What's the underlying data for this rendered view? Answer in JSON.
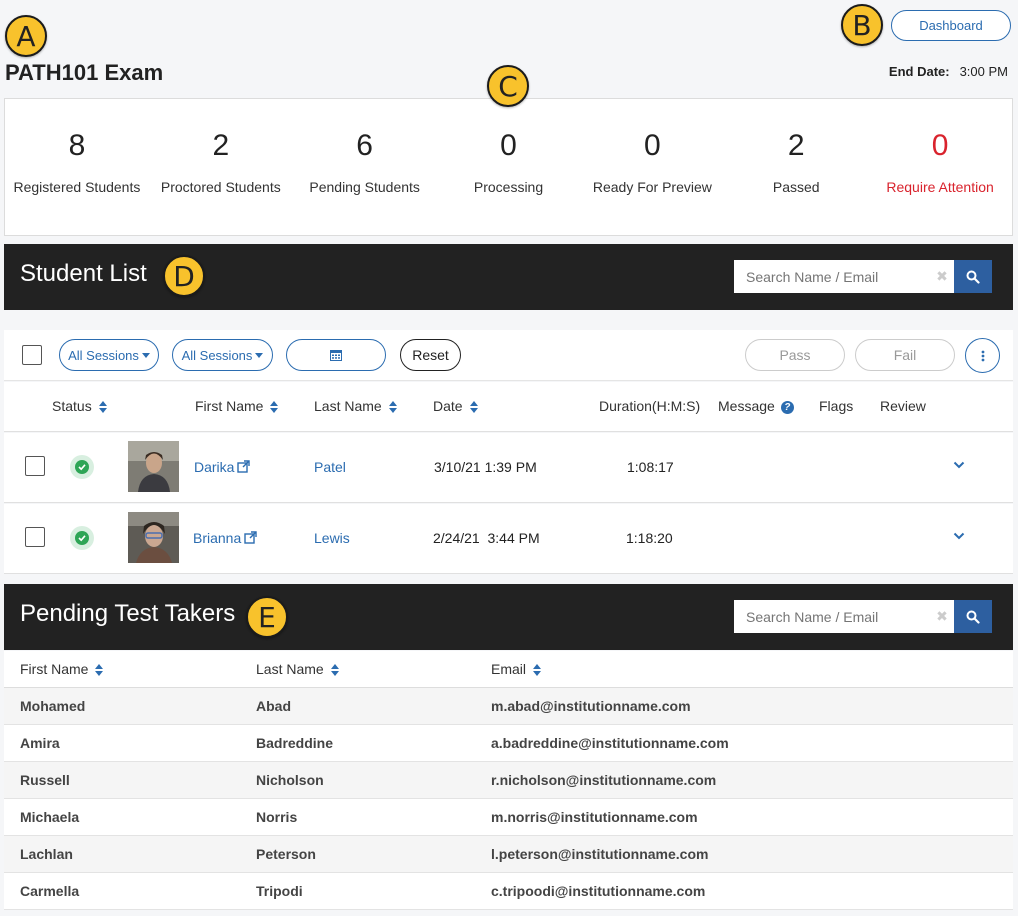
{
  "annotations": [
    "A",
    "B",
    "C",
    "D",
    "E"
  ],
  "header": {
    "title": "PATH101 Exam",
    "dashboard_label": "Dashboard",
    "end_date_label": "End Date:",
    "end_date_value": "3:00 PM"
  },
  "stats": [
    {
      "value": "8",
      "label": "Registered Students"
    },
    {
      "value": "2",
      "label": "Proctored Students"
    },
    {
      "value": "6",
      "label": "Pending Students"
    },
    {
      "value": "0",
      "label": "Processing"
    },
    {
      "value": "0",
      "label": "Ready For Preview"
    },
    {
      "value": "2",
      "label": "Passed"
    },
    {
      "value": "0",
      "label": "Require Attention"
    }
  ],
  "student_list": {
    "title": "Student List",
    "search_placeholder": "Search Name / Email",
    "filters": {
      "session1": "All Sessions",
      "session2": "All Sessions",
      "reset": "Reset",
      "pass": "Pass",
      "fail": "Fail"
    },
    "columns": {
      "status": "Status",
      "first_name": "First Name",
      "last_name": "Last Name",
      "date": "Date",
      "duration": "Duration(H:M:S)",
      "message": "Message",
      "flags": "Flags",
      "review": "Review"
    },
    "rows": [
      {
        "first": "Darika",
        "last": "Patel",
        "date": "3/10/21 1:39 PM",
        "duration": "1:08:17"
      },
      {
        "first": "Brianna",
        "last": "Lewis",
        "date": "2/24/21  3:44 PM",
        "duration": "1:18:20"
      }
    ]
  },
  "pending": {
    "title": "Pending Test Takers",
    "search_placeholder": "Search Name / Email",
    "columns": {
      "first_name": "First Name",
      "last_name": "Last Name",
      "email": "Email"
    },
    "rows": [
      {
        "first": "Mohamed",
        "last": "Abad",
        "email": "m.abad@institutionname.com"
      },
      {
        "first": "Amira",
        "last": "Badreddine",
        "email": "a.badreddine@institutionname.com"
      },
      {
        "first": "Russell",
        "last": "Nicholson",
        "email": "r.nicholson@institutionname.com"
      },
      {
        "first": "Michaela",
        "last": "Norris",
        "email": "m.norris@institutionname.com"
      },
      {
        "first": "Lachlan",
        "last": "Peterson",
        "email": "l.peterson@institutionname.com"
      },
      {
        "first": "Carmella",
        "last": "Tripodi",
        "email": "c.tripoodi@institutionname.com"
      }
    ]
  }
}
